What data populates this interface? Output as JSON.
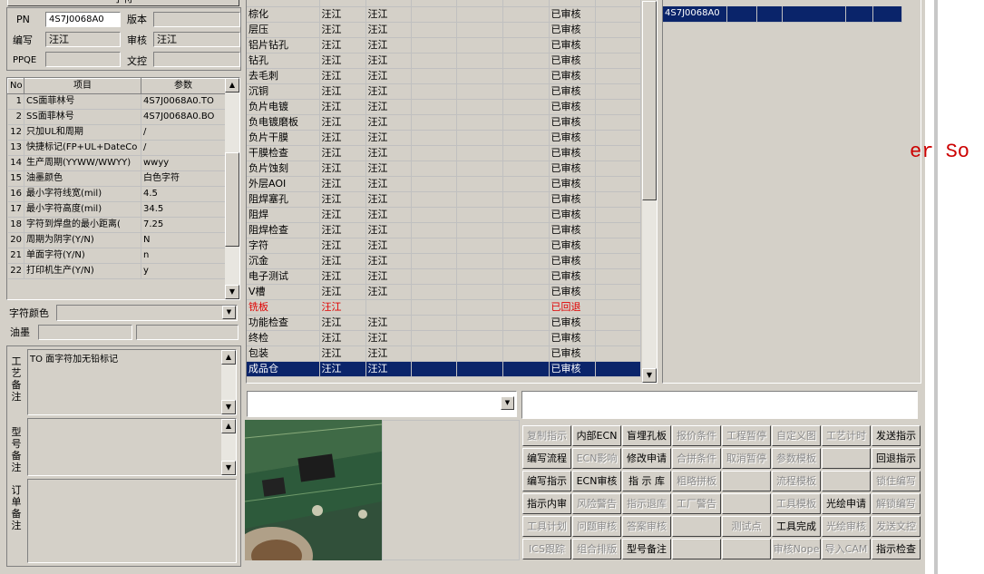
{
  "top_header": "字符",
  "form": {
    "pn_label": "PN",
    "pn_value": "4S7J0068A0",
    "version_label": "版本",
    "version_value": "",
    "editor_label": "编写",
    "editor_value": "汪江",
    "review_label": "审核",
    "review_value": "汪江",
    "ppqe_label": "PPQE",
    "ppqe_value": "",
    "doc_label": "文控",
    "doc_value": ""
  },
  "params": {
    "headers": [
      "No",
      "项目",
      "参数"
    ],
    "rows": [
      [
        "1",
        "CS面菲林号",
        "4S7J0068A0.TO"
      ],
      [
        "2",
        "SS面菲林号",
        "4S7J0068A0.BO"
      ],
      [
        "12",
        "只加UL和周期",
        "/"
      ],
      [
        "13",
        "快捷标记(FP+UL+DateCo",
        "/"
      ],
      [
        "14",
        "生产周期(YYWW/WWYY)",
        "wwyy"
      ],
      [
        "15",
        "油墨颜色",
        "白色字符"
      ],
      [
        "16",
        "最小字符线宽(mil)",
        "4.5"
      ],
      [
        "17",
        "最小字符高度(mil)",
        "34.5"
      ],
      [
        "18",
        "字符到焊盘的最小距离(",
        "7.25"
      ],
      [
        "20",
        "周期为阴字(Y/N)",
        "N"
      ],
      [
        "21",
        "单面字符(Y/N)",
        "n"
      ],
      [
        "22",
        "打印机生产(Y/N)",
        "y"
      ]
    ]
  },
  "char_color_label": "字符颜色",
  "char_color_value": "",
  "ink_label": "油墨",
  "ink_value_1": "",
  "ink_value_2": "",
  "notes": {
    "process_label": "工艺备注",
    "process_text": "TO 面字符加无铅标记",
    "model_label": "型号备注",
    "model_text": "",
    "order_label": "订单备注",
    "order_text": ""
  },
  "process_grid": {
    "rows": [
      [
        "棕化",
        "汪江",
        "汪江",
        "",
        "",
        "",
        "已审核",
        ""
      ],
      [
        "层压",
        "汪江",
        "汪江",
        "",
        "",
        "",
        "已审核",
        ""
      ],
      [
        "铝片钻孔",
        "汪江",
        "汪江",
        "",
        "",
        "",
        "已审核",
        ""
      ],
      [
        "钻孔",
        "汪江",
        "汪江",
        "",
        "",
        "",
        "已审核",
        ""
      ],
      [
        "去毛刺",
        "汪江",
        "汪江",
        "",
        "",
        "",
        "已审核",
        ""
      ],
      [
        "沉铜",
        "汪江",
        "汪江",
        "",
        "",
        "",
        "已审核",
        ""
      ],
      [
        "负片电镀",
        "汪江",
        "汪江",
        "",
        "",
        "",
        "已审核",
        ""
      ],
      [
        "负电镀磨板",
        "汪江",
        "汪江",
        "",
        "",
        "",
        "已审核",
        ""
      ],
      [
        "负片干膜",
        "汪江",
        "汪江",
        "",
        "",
        "",
        "已审核",
        ""
      ],
      [
        "干膜检查",
        "汪江",
        "汪江",
        "",
        "",
        "",
        "已审核",
        ""
      ],
      [
        "负片蚀刻",
        "汪江",
        "汪江",
        "",
        "",
        "",
        "已审核",
        ""
      ],
      [
        "外层AOI",
        "汪江",
        "汪江",
        "",
        "",
        "",
        "已审核",
        ""
      ],
      [
        "阻焊塞孔",
        "汪江",
        "汪江",
        "",
        "",
        "",
        "已审核",
        ""
      ],
      [
        "阻焊",
        "汪江",
        "汪江",
        "",
        "",
        "",
        "已审核",
        ""
      ],
      [
        "阻焊检查",
        "汪江",
        "汪江",
        "",
        "",
        "",
        "已审核",
        ""
      ],
      [
        "字符",
        "汪江",
        "汪江",
        "",
        "",
        "",
        "已审核",
        ""
      ],
      [
        "沉金",
        "汪江",
        "汪江",
        "",
        "",
        "",
        "已审核",
        ""
      ],
      [
        "电子测试",
        "汪江",
        "汪江",
        "",
        "",
        "",
        "已审核",
        ""
      ],
      [
        "V槽",
        "汪江",
        "汪江",
        "",
        "",
        "",
        "已审核",
        ""
      ],
      [
        "铣板",
        "汪江",
        "",
        "",
        "",
        "",
        "已回退",
        ""
      ],
      [
        "功能检查",
        "汪江",
        "汪江",
        "",
        "",
        "",
        "已审核",
        ""
      ],
      [
        "终检",
        "汪江",
        "汪江",
        "",
        "",
        "",
        "已审核",
        ""
      ],
      [
        "包装",
        "汪江",
        "汪江",
        "",
        "",
        "",
        "已审核",
        ""
      ],
      [
        "成品仓",
        "汪江",
        "汪江",
        "",
        "",
        "",
        "已审核",
        ""
      ]
    ],
    "selected_row": 23,
    "rejected_row": 19
  },
  "right_list": {
    "row": [
      "4S7J0068A0",
      "",
      "",
      "",
      "",
      ""
    ]
  },
  "side_fragment_text": "er So",
  "lower_combo_value": "",
  "lower_text_value": "",
  "buttons": [
    [
      {
        "label": "复制指示",
        "enabled": false
      },
      {
        "label": "内部ECN",
        "enabled": true
      },
      {
        "label": "盲埋孔板",
        "enabled": true
      },
      {
        "label": "报价条件",
        "enabled": false
      },
      {
        "label": "工程暂停",
        "enabled": false
      },
      {
        "label": "自定义图",
        "enabled": false
      },
      {
        "label": "工艺计时",
        "enabled": false
      },
      {
        "label": "发送指示",
        "enabled": true
      }
    ],
    [
      {
        "label": "编写流程",
        "enabled": true
      },
      {
        "label": "ECN影响",
        "enabled": false
      },
      {
        "label": "修改申请",
        "enabled": true
      },
      {
        "label": "合拼条件",
        "enabled": false
      },
      {
        "label": "取消暂停",
        "enabled": false
      },
      {
        "label": "参数模板",
        "enabled": false
      },
      {
        "label": "",
        "enabled": false
      },
      {
        "label": "回退指示",
        "enabled": true
      }
    ],
    [
      {
        "label": "编写指示",
        "enabled": true
      },
      {
        "label": "ECN审核",
        "enabled": true
      },
      {
        "label": "指 示 库",
        "enabled": true
      },
      {
        "label": "粗略拼板",
        "enabled": false
      },
      {
        "label": "",
        "enabled": false
      },
      {
        "label": "流程模板",
        "enabled": false
      },
      {
        "label": "",
        "enabled": false
      },
      {
        "label": "锁住编写",
        "enabled": false
      }
    ],
    [
      {
        "label": "指示内审",
        "enabled": true
      },
      {
        "label": "风险警告",
        "enabled": false
      },
      {
        "label": "指示退库",
        "enabled": false
      },
      {
        "label": "工厂警告",
        "enabled": false
      },
      {
        "label": "",
        "enabled": false
      },
      {
        "label": "工具模板",
        "enabled": false
      },
      {
        "label": "光绘申请",
        "enabled": true
      },
      {
        "label": "解锁编写",
        "enabled": false
      }
    ],
    [
      {
        "label": "工具计划",
        "enabled": false
      },
      {
        "label": "问题审核",
        "enabled": false
      },
      {
        "label": "答案审核",
        "enabled": false
      },
      {
        "label": "",
        "enabled": false
      },
      {
        "label": "测试点",
        "enabled": false
      },
      {
        "label": "工具完成",
        "enabled": true
      },
      {
        "label": "光绘审核",
        "enabled": false
      },
      {
        "label": "发送文控",
        "enabled": false
      }
    ],
    [
      {
        "label": "ICS跟踪",
        "enabled": false
      },
      {
        "label": "组合排版",
        "enabled": false
      },
      {
        "label": "型号备注",
        "enabled": true
      },
      {
        "label": "",
        "enabled": false
      },
      {
        "label": "",
        "enabled": false
      },
      {
        "label": "审核Nope",
        "enabled": false
      },
      {
        "label": "导入CAM",
        "enabled": false
      },
      {
        "label": "指示检查",
        "enabled": true
      }
    ]
  ]
}
